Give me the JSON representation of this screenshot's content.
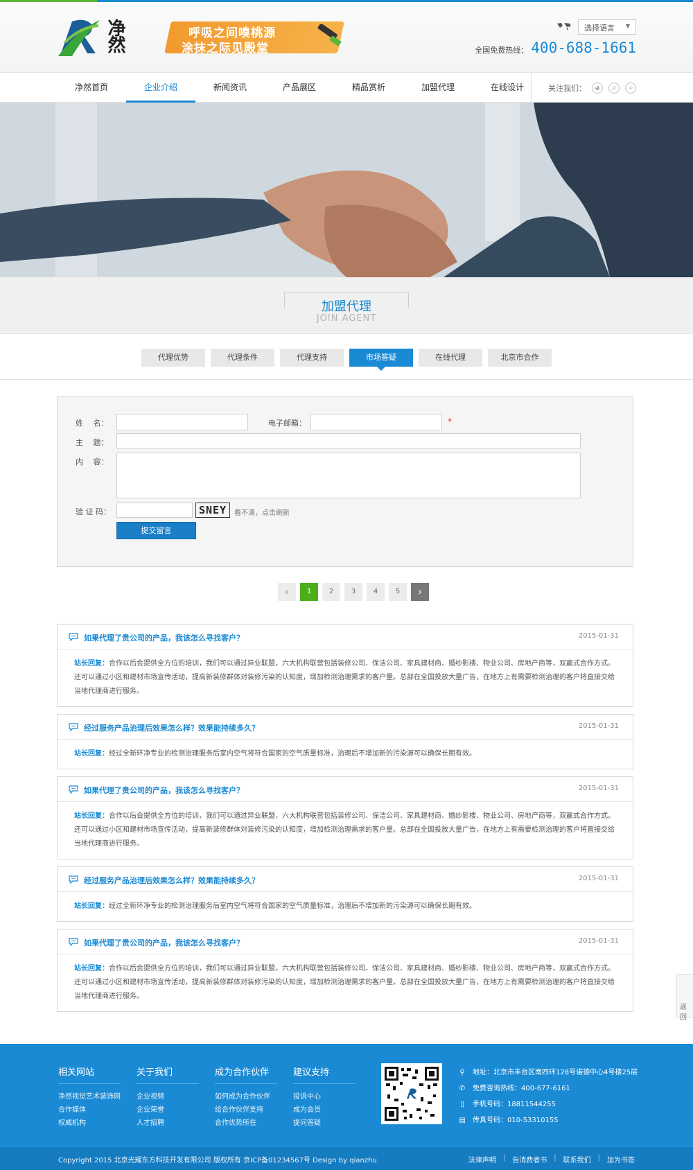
{
  "header": {
    "slogan_line1": "呼吸之间嗅桃源",
    "slogan_line2": "涂抹之际见殿堂",
    "lang_select": "选择语言",
    "hotline_label": "全国免费热线：",
    "hotline_number": "400-688-1661",
    "logo_text": "净然"
  },
  "nav": {
    "items": [
      "净然首页",
      "企业介绍",
      "新闻资讯",
      "产品展区",
      "精品赏析",
      "加盟代理",
      "在线设计"
    ],
    "active_index": 1,
    "follow_label": "关注我们："
  },
  "section": {
    "title_cn": "加盟代理",
    "title_en": "JOIN AGENT"
  },
  "subtabs": {
    "items": [
      "代理优势",
      "代理条件",
      "代理支持",
      "市场答疑",
      "在线代理",
      "北京市合作"
    ],
    "active_index": 3
  },
  "form": {
    "name_label": "姓　 名：",
    "email_label": "电子邮箱：",
    "required_mark": "*",
    "subject_label": "主　 题：",
    "content_label": "内　 容：",
    "captcha_label": "验 证 码：",
    "captcha_code": "SNEY",
    "refresh_text": "看不清，点击刷新",
    "submit_label": "提交留言"
  },
  "pager": {
    "prev": "‹",
    "next": "›",
    "pages": [
      "1",
      "2",
      "3",
      "4",
      "5"
    ],
    "current": "1"
  },
  "qa": [
    {
      "q": "如果代理了贵公司的产品，我该怎么寻找客户？",
      "date": "2015-01-31",
      "reply_label": "站长回复：",
      "a": "合作以后会提供全方位的培训，我们可以通过异业联盟，六大机构联营包括装修公司、保洁公司、家具建材商、婚纱影楼、物业公司、房地产商等，双赢式合作方式。还可以通过小区和建材市场宣传活动，提高新装修群体对装修污染的认知度，增加检测治理需求的客户量。总部在全国投放大量广告，在地方上有需要检测治理的客户将直接交给当地代理商进行服务。"
    },
    {
      "q": "经过服务产品治理后效果怎么样？效果能持续多久？",
      "date": "2015-01-31",
      "reply_label": "站长回复：",
      "a": "经过全新环净专业的检测治理服务后室内空气将符合国家的空气质量标准，治理后不增加新的污染源可以确保长期有效。"
    },
    {
      "q": "如果代理了贵公司的产品，我该怎么寻找客户？",
      "date": "2015-01-31",
      "reply_label": "站长回复：",
      "a": "合作以后会提供全方位的培训，我们可以通过异业联盟，六大机构联营包括装修公司、保洁公司、家具建材商、婚纱影楼、物业公司、房地产商等，双赢式合作方式。还可以通过小区和建材市场宣传活动，提高新装修群体对装修污染的认知度，增加检测治理需求的客户量。总部在全国投放大量广告，在地方上有需要检测治理的客户将直接交给当地代理商进行服务。"
    },
    {
      "q": "经过服务产品治理后效果怎么样？效果能持续多久？",
      "date": "2015-01-31",
      "reply_label": "站长回复：",
      "a": "经过全新环净专业的检测治理服务后室内空气将符合国家的空气质量标准，治理后不增加新的污染源可以确保长期有效。"
    },
    {
      "q": "如果代理了贵公司的产品，我该怎么寻找客户？",
      "date": "2015-01-31",
      "reply_label": "站长回复：",
      "a": "合作以后会提供全方位的培训，我们可以通过异业联盟，六大机构联营包括装修公司、保洁公司、家具建材商、婚纱影楼、物业公司、房地产商等，双赢式合作方式。还可以通过小区和建材市场宣传活动，提高新装修群体对装修污染的认知度，增加检测治理需求的客户量。总部在全国投放大量广告，在地方上有需要检测治理的客户将直接交给当地代理商进行服务。"
    }
  ],
  "footer": {
    "cols": [
      {
        "title": "相关网站",
        "links": [
          "净然视觉艺术装饰网",
          "合作媒体",
          "权威机构"
        ]
      },
      {
        "title": "关于我们",
        "links": [
          "企业视频",
          "企业荣誉",
          "人才招聘"
        ]
      },
      {
        "title": "成为合作伙伴",
        "links": [
          "如何成为合作伙伴",
          "给合作伙伴支持",
          "合作优势所在"
        ]
      },
      {
        "title": "建议支持",
        "links": [
          "投诉中心",
          "成为会员",
          "提问答疑"
        ]
      }
    ],
    "contact": {
      "address": "地址：北京市丰台区南四环128号诺德中心4号楼25层",
      "consult": "免费咨询热线：400-677-6161",
      "mobile": "手机号码：18811544255",
      "fax": "传真号码：010-53310155"
    },
    "copyright": "Copyright 2015 北京光耀东方科技开发有限公司 版权所有  京ICP备01234567号  Design by qianzhu",
    "links": [
      "法律声明",
      "告消费者书",
      "联系我们",
      "加为书签"
    ],
    "separator": "|"
  },
  "backtop": "返回",
  "colors": {
    "brand_blue": "#1a8ad4",
    "pager_green": "#4caf1a",
    "slogan_orange": "#f29a2e"
  }
}
